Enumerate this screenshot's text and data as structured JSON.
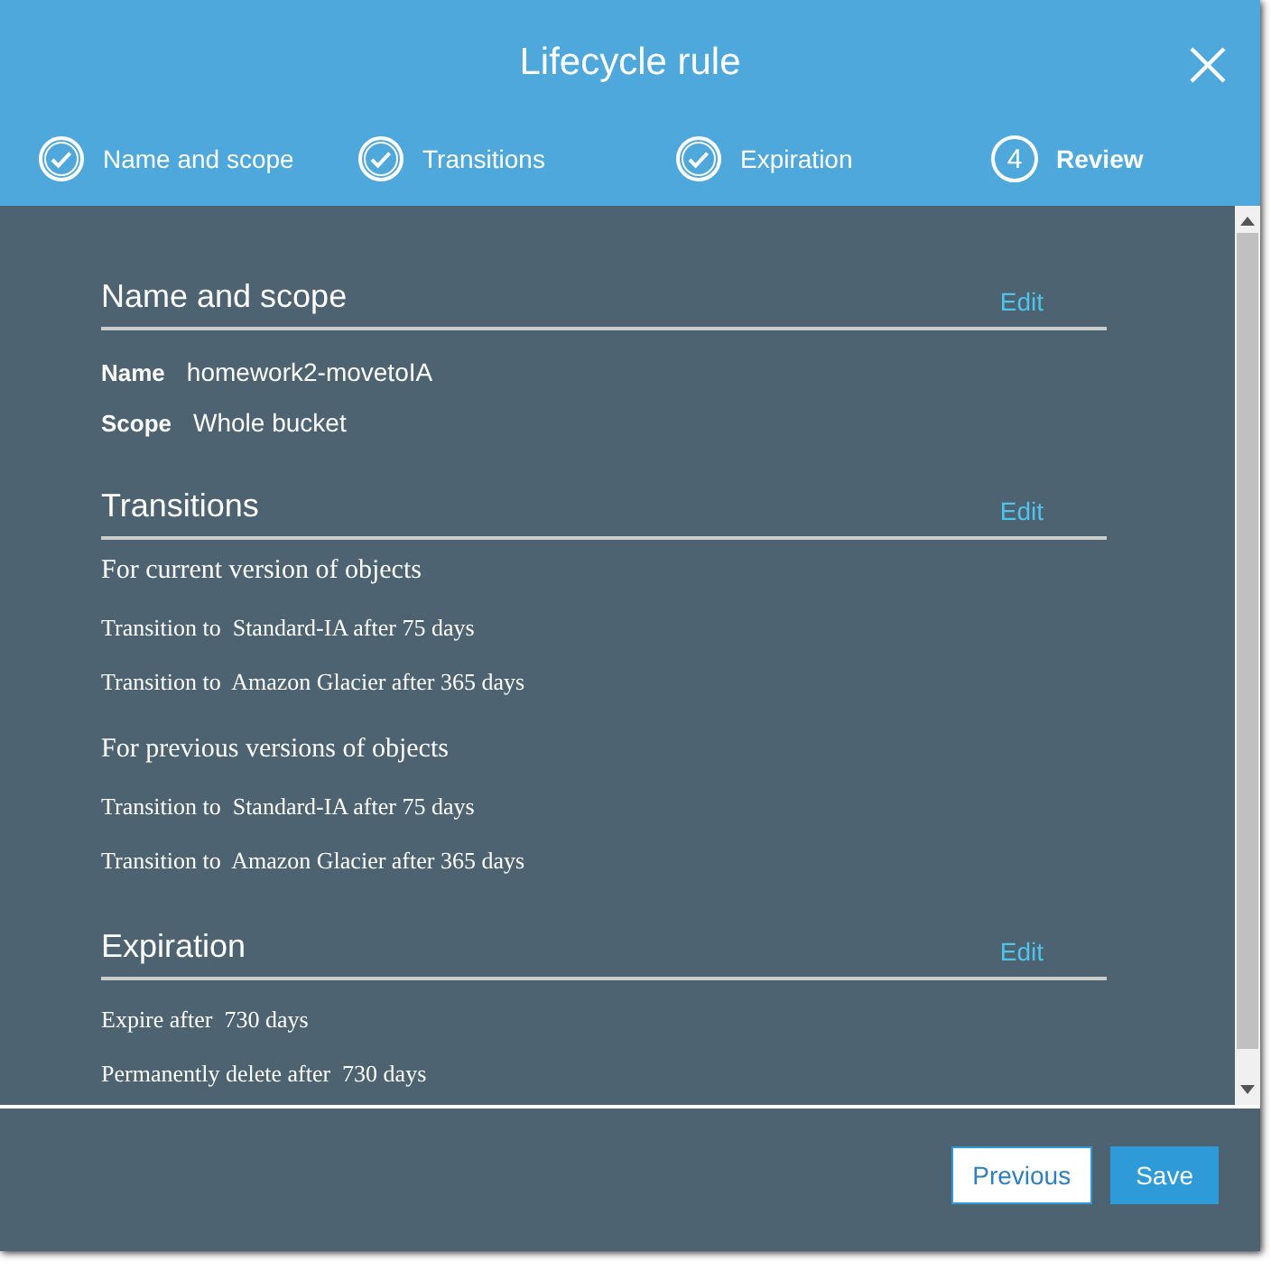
{
  "dialog": {
    "title": "Lifecycle rule"
  },
  "steps": [
    {
      "label": "Name and scope",
      "completed": true
    },
    {
      "label": "Transitions",
      "completed": true
    },
    {
      "label": "Expiration",
      "completed": true
    },
    {
      "label": "Review",
      "completed": false,
      "number": "4"
    }
  ],
  "sections": [
    {
      "heading": "Name and scope",
      "edit": "Edit",
      "fields": [
        {
          "label": "Name",
          "value": "homework2-movetoIA"
        },
        {
          "label": "Scope",
          "value": "Whole bucket"
        }
      ]
    },
    {
      "heading": "Transitions",
      "edit": "Edit",
      "groups": [
        {
          "title": "For current version of objects",
          "lines": [
            "Transition to  Standard-IA after 75 days",
            "Transition to  Amazon Glacier after 365 days"
          ]
        },
        {
          "title": "For previous versions of objects",
          "lines": [
            "Transition to  Standard-IA after 75 days",
            "Transition to  Amazon Glacier after 365 days"
          ]
        }
      ]
    },
    {
      "heading": "Expiration",
      "edit": "Edit",
      "groups": [
        {
          "lines": [
            "Expire after  730 days",
            "Permanently delete after  730 days"
          ]
        }
      ]
    }
  ],
  "buttons": {
    "previous": "Previous",
    "save": "Save"
  }
}
